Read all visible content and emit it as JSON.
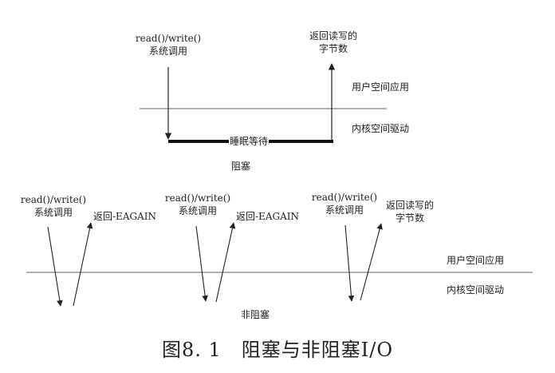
{
  "blocking": {
    "syscall_line1": "read()/write()",
    "syscall_line2": "系统调用",
    "return_line1": "返回读写的",
    "return_line2": "字节数",
    "user_space": "用户空间应用",
    "kernel_space": "内核空间驱动",
    "sleep_label": "睡眠等待",
    "title": "阻塞"
  },
  "nonblocking": {
    "call1_line1": "read()/write()",
    "call1_line2": "系统调用",
    "return1": "返回-EAGAIN",
    "call2_line1": "read()/write()",
    "call2_line2": "系统调用",
    "return2": "返回-EAGAIN",
    "call3_line1": "read()/write()",
    "call3_line2": "系统调用",
    "return3_line1": "返回读写的",
    "return3_line2": "字节数",
    "user_space": "用户空间应用",
    "kernel_space": "内核空间驱动",
    "title": "非阻塞"
  },
  "caption": "图8. 1　阻塞与非阻塞I/O",
  "colors": {
    "line": "#555555",
    "arrow": "#222222",
    "sleep_bar": "#111111"
  }
}
